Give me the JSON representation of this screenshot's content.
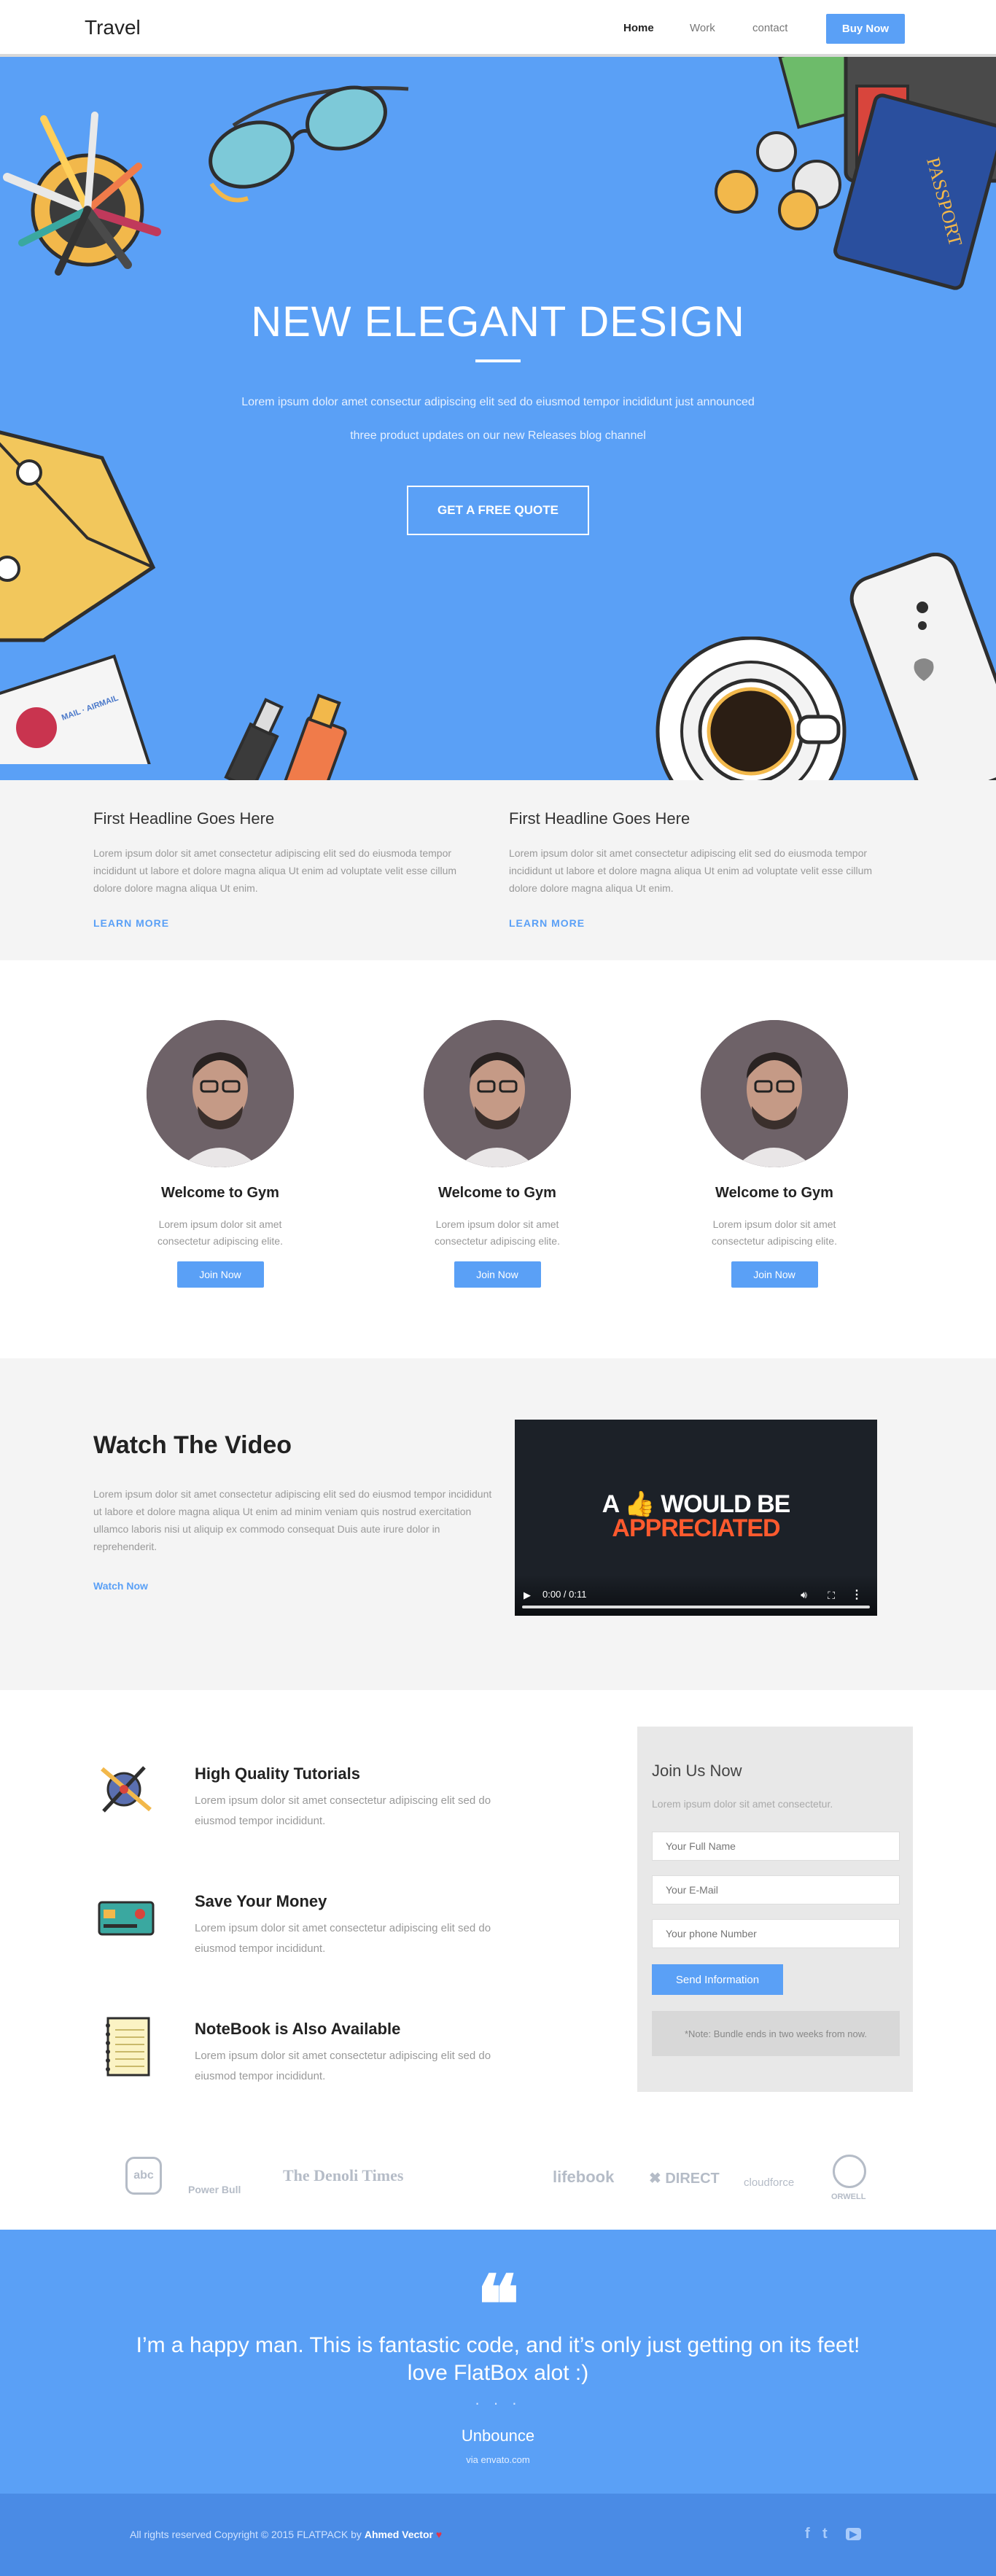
{
  "header": {
    "logo": "Travel",
    "nav": [
      "Home",
      "Work",
      "contact"
    ],
    "cta": "Buy Now"
  },
  "hero": {
    "title": "NEW ELEGANT DESIGN",
    "subtitle_line1": "Lorem ipsum dolor amet consectur adipiscing elit sed do eiusmod tempor incididunt just announced",
    "subtitle_line2": "three product updates on our new Releases blog channel",
    "cta": "GET A FREE QUOTE",
    "passport_text": "PASSPORT",
    "envelope_text": "MAIL · AIRMAIL"
  },
  "features": [
    {
      "title": "First Headline Goes Here",
      "text": "Lorem ipsum dolor sit amet consectetur adipiscing elit sed do eiusmoda tempor incididunt ut labore et dolore magna aliqua Ut enim ad voluptate velit esse cillum dolore dolore magna aliqua Ut enim.",
      "link": "LEARN MORE"
    },
    {
      "title": "First Headline Goes Here",
      "text": "Lorem ipsum dolor sit amet consectetur adipiscing elit sed do eiusmoda tempor incididunt ut labore et dolore magna aliqua Ut enim ad voluptate velit esse cillum dolore dolore magna aliqua Ut enim.",
      "link": "LEARN MORE"
    }
  ],
  "team": [
    {
      "title": "Welcome to Gym",
      "text": "Lorem ipsum dolor sit amet consectetur adipiscing elite.",
      "button": "Join Now"
    },
    {
      "title": "Welcome to Gym",
      "text": "Lorem ipsum dolor sit amet consectetur adipiscing elite.",
      "button": "Join Now"
    },
    {
      "title": "Welcome to Gym",
      "text": "Lorem ipsum dolor sit amet consectetur adipiscing elite.",
      "button": "Join Now"
    }
  ],
  "video": {
    "title": "Watch The Video",
    "text": "Lorem ipsum dolor sit amet consectetur adipiscing elit sed do eiusmod tempor incididunt ut labore et dolore magna aliqua Ut enim ad minim veniam quis nostrud exercitation ullamco laboris nisi ut aliquip ex commodo consequat Duis aute irure dolor in reprehenderit.",
    "link": "Watch Now",
    "player_line1_a": "A",
    "player_line1_b": "WOULD BE",
    "player_line2": "APPRECIATED",
    "time": "0:00 / 0:11",
    "progress": 0
  },
  "services": [
    {
      "title": "High Quality Tutorials",
      "text": "Lorem ipsum dolor sit amet consectetur adipiscing elit sed do eiusmod tempor incididunt.",
      "icon": "compass-pen-icon"
    },
    {
      "title": "Save Your Money",
      "text": "Lorem ipsum dolor sit amet consectetur adipiscing elit sed do eiusmod tempor incididunt.",
      "icon": "credit-card-icon"
    },
    {
      "title": "NoteBook is Also Available",
      "text": "Lorem ipsum dolor sit amet consectetur adipiscing elit sed do eiusmod tempor incididunt.",
      "icon": "notebook-icon"
    }
  ],
  "form": {
    "title": "Join Us Now",
    "text": "Lorem ipsum dolor sit amet consectetur.",
    "name_placeholder": "Your Full Name",
    "email_placeholder": "Your E-Mail",
    "phone_placeholder": "Your phone Number",
    "button": "Send Information",
    "note": "*Note: Bundle ends in two weeks from now."
  },
  "logos": [
    "abc",
    "Power Bull",
    "The Denoli Times",
    "lifebook",
    "DIRECT",
    "cloudforce",
    "ORWELL"
  ],
  "testimonial": {
    "quote": "I’m a happy man. This is fantastic code, and it’s only just getting on its feet! love FlatBox alot :)",
    "dots": "· · ·",
    "name": "Unbounce",
    "source": "via envato.com"
  },
  "footer": {
    "copyright": "All rights reserved Copyright © 2015 FLATPACK by",
    "author": "Ahmed Vector",
    "heart": "♥",
    "social": [
      "f",
      "t",
      "▶"
    ]
  },
  "colors": {
    "accent": "#5aa0f6",
    "footer": "#4a8be5",
    "section_gray": "#f4f4f4"
  }
}
